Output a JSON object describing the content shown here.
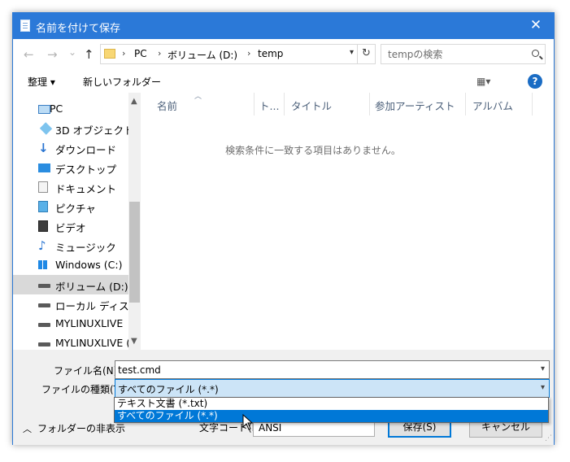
{
  "window": {
    "title": "名前を付けて保存",
    "close_glyph": "✕"
  },
  "nav_buttons": {
    "back": "←",
    "forward": "→",
    "recent": "⌄",
    "up": "↑"
  },
  "address": {
    "crumbs": [
      "PC",
      "ボリューム (D:)",
      "temp"
    ],
    "separator": "›"
  },
  "search": {
    "placeholder": "tempの検索"
  },
  "toolbar": {
    "organize_label": "整理 ▾",
    "new_folder_label": "新しいフォルダー",
    "view_label": "▦▾",
    "help_label": "?"
  },
  "sidebar": {
    "items": [
      {
        "label": "PC",
        "icon": "pc-icon"
      },
      {
        "label": "3D オブジェクト",
        "icon": "3d-objects-icon"
      },
      {
        "label": "ダウンロード",
        "icon": "download-icon"
      },
      {
        "label": "デスクトップ",
        "icon": "desktop-icon"
      },
      {
        "label": "ドキュメント",
        "icon": "documents-icon"
      },
      {
        "label": "ピクチャ",
        "icon": "pictures-icon"
      },
      {
        "label": "ビデオ",
        "icon": "video-icon"
      },
      {
        "label": "ミュージック",
        "icon": "music-icon"
      },
      {
        "label": "Windows (C:)",
        "icon": "windows-drive-icon"
      },
      {
        "label": "ボリューム (D:)",
        "icon": "drive-icon",
        "selected": true
      },
      {
        "label": "ローカル ディスク",
        "icon": "drive-icon"
      },
      {
        "label": "MYLINUXLIVE",
        "icon": "drive-icon"
      },
      {
        "label": "MYLINUXLIVE (",
        "icon": "drive-icon"
      }
    ]
  },
  "file_list": {
    "columns": [
      "名前",
      "ト...",
      "タイトル",
      "参加アーティスト",
      "アルバム"
    ],
    "empty_message": "検索条件に一致する項目はありません。"
  },
  "form": {
    "filename_label": "ファイル名(N):",
    "filename_value": "test.cmd",
    "filetype_label": "ファイルの種類(T):",
    "filetype_value": "すべてのファイル  (*.*)",
    "encoding_label": "文字コード(E):",
    "encoding_value": "ANSI",
    "save_label": "保存(S)",
    "cancel_label": "キャンセル",
    "hide_folders_label": "フォルダーの非表示"
  },
  "filetype_options": [
    {
      "label": "テキスト文書 (*.txt)",
      "selected": false
    },
    {
      "label": "すべてのファイル  (*.*)",
      "selected": true
    }
  ],
  "colors": {
    "titlebar": "#2b79d8",
    "selection": "#0078d7",
    "selected_field": "#cce4f7"
  }
}
